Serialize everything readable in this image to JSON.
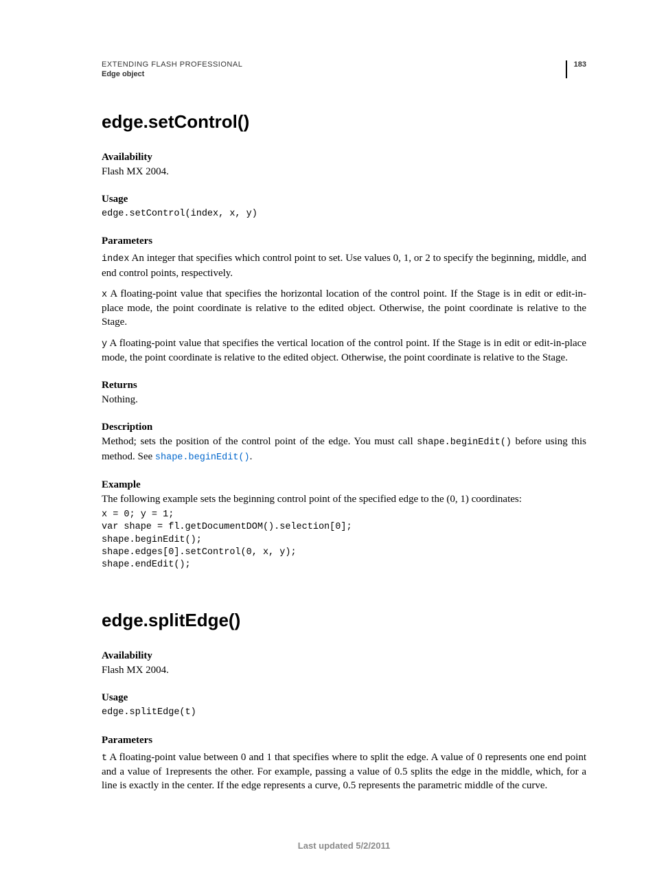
{
  "header": {
    "doc_title": "EXTENDING FLASH PROFESSIONAL",
    "subtitle": "Edge object",
    "page_number": "183"
  },
  "section1": {
    "title": "edge.setControl()",
    "availability_label": "Availability",
    "availability_text": "Flash MX 2004.",
    "usage_label": "Usage",
    "usage_code": "edge.setControl(index, x, y)",
    "parameters_label": "Parameters",
    "param_index_name": "index",
    "param_index_text": "  An integer that specifies which control point to set. Use values 0, 1, or 2 to specify the beginning, middle, and end control points, respectively.",
    "param_x_name": "x",
    "param_x_text": " A floating-point value that specifies the horizontal location of the control point. If the Stage is in edit or edit-in-place mode, the point coordinate is relative to the edited object. Otherwise, the point coordinate is relative to the Stage.",
    "param_y_name": "y",
    "param_y_text": " A floating-point value that specifies the vertical location of the control point. If the Stage is in edit or edit-in-place mode, the point coordinate is relative to the edited object. Otherwise, the point coordinate is relative to the Stage.",
    "returns_label": "Returns",
    "returns_text": "Nothing.",
    "description_label": "Description",
    "description_text_a": "Method; sets the position of the control point of the edge. You must call ",
    "description_inline_code": "shape.beginEdit()",
    "description_text_b": " before using this method. See ",
    "description_link": "shape.beginEdit()",
    "description_text_c": ".",
    "example_label": "Example",
    "example_text": "The following example sets the beginning control point of the specified edge to the (0, 1) coordinates:",
    "example_code": "x = 0; y = 1;\nvar shape = fl.getDocumentDOM().selection[0];\nshape.beginEdit();\nshape.edges[0].setControl(0, x, y);\nshape.endEdit();"
  },
  "section2": {
    "title": "edge.splitEdge()",
    "availability_label": "Availability",
    "availability_text": "Flash MX 2004.",
    "usage_label": "Usage",
    "usage_code": "edge.splitEdge(t)",
    "parameters_label": "Parameters",
    "param_t_name": "t",
    "param_t_text": " A floating-point value between 0 and 1 that specifies where to split the edge. A value of 0 represents one end point and a value of 1represents the other. For example, passing a value of 0.5 splits the edge in the middle, which, for a line is exactly in the center. If the edge represents a curve, 0.5 represents the parametric middle of the curve."
  },
  "footer": {
    "text": "Last updated 5/2/2011"
  }
}
